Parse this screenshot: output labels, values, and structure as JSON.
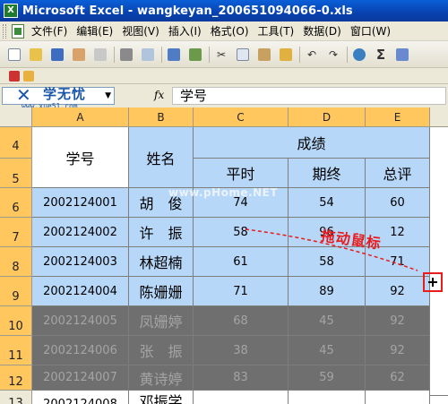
{
  "window": {
    "title": "Microsoft Excel - wangkeyan_200651094066-0.xls",
    "app_icon": "excel-icon"
  },
  "menu": [
    "文件(F)",
    "编辑(E)",
    "视图(V)",
    "插入(I)",
    "格式(O)",
    "工具(T)",
    "数据(D)",
    "窗口(W)"
  ],
  "formula_bar": {
    "fx": "fx",
    "value": "学号"
  },
  "logo": {
    "name": "学无忧",
    "url": "www.xue51.com"
  },
  "watermark": "www.pHome.NET",
  "columns": [
    "A",
    "B",
    "C",
    "D",
    "E"
  ],
  "rows": [
    "4",
    "5",
    "6",
    "7",
    "8",
    "9",
    "10",
    "11",
    "12",
    "13"
  ],
  "header": {
    "student_id": "学号",
    "name": "姓名",
    "grades": "成绩",
    "regular": "平时",
    "final": "期终",
    "total": "总评"
  },
  "records": [
    {
      "id": "2002124001",
      "name": "胡　俊",
      "regular": "74",
      "final": "54",
      "total": "60"
    },
    {
      "id": "2002124002",
      "name": "许　振",
      "regular": "58",
      "final": "96",
      "total": "12"
    },
    {
      "id": "2002124003",
      "name": "林超楠",
      "regular": "61",
      "final": "58",
      "total": "71"
    },
    {
      "id": "2002124004",
      "name": "陈姗姗",
      "regular": "71",
      "final": "89",
      "total": "92"
    }
  ],
  "blurred_rows": [
    {
      "id": "2002124005",
      "name": "凤姗婷",
      "regular": "68",
      "final": "45",
      "total": "92"
    },
    {
      "id": "2002124006",
      "name": "张　振",
      "regular": "38",
      "final": "45",
      "total": "92"
    },
    {
      "id": "2002124007",
      "name": "黄诗婷",
      "regular": "83",
      "final": "59",
      "total": "62"
    }
  ],
  "partial_row": {
    "id": "2002124008",
    "name": "邓振学"
  },
  "annotation": {
    "text": "拖动鼠标",
    "color": "#e81c1c"
  },
  "colors": {
    "blue_fill": "#b7d7f8",
    "selection_fill": "#6f6f6f",
    "header_highlight": "#ffc75e"
  }
}
